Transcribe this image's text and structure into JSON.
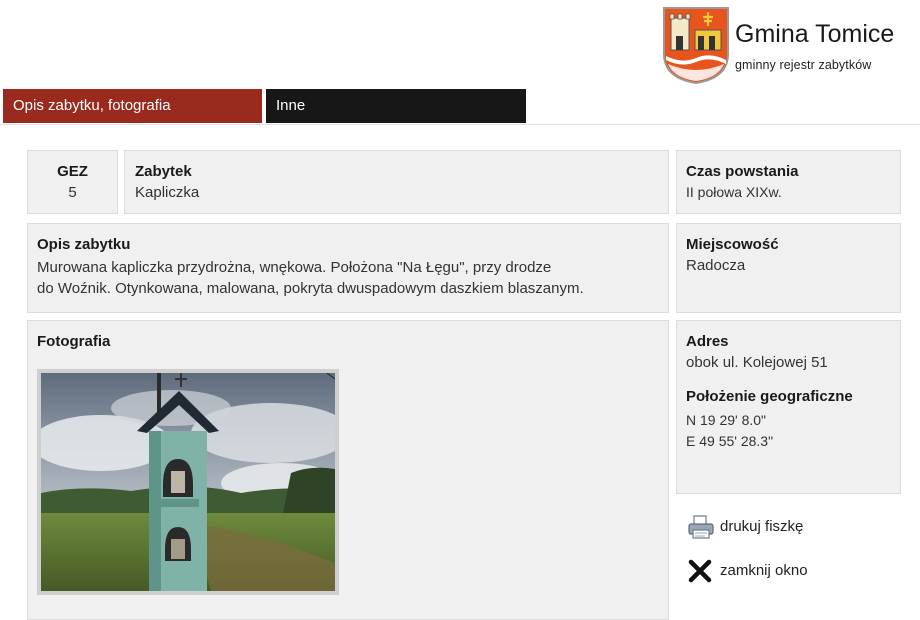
{
  "logo": {
    "title": "Gmina Tomice",
    "subtitle": "gminny rejestr zabytków"
  },
  "tabs": [
    {
      "label": "Opis zabytku, fotografia",
      "active": true
    },
    {
      "label": "Inne",
      "active": false
    }
  ],
  "colors": {
    "tab_active": "#9b2a1e",
    "tab_inactive": "#171717",
    "panel_bg": "#f0f0f0"
  },
  "record": {
    "gez": {
      "label": "GEZ",
      "value": "5"
    },
    "zabytek": {
      "label": "Zabytek",
      "value": "Kapliczka"
    },
    "czas": {
      "label": "Czas powstania",
      "value": "II połowa XIXw."
    },
    "opis": {
      "label": "Opis zabytku",
      "line1": "Murowana kapliczka przydrożna, wnękowa. Położona \"Na Łęgu\", przy drodze",
      "line2": "do Woźnik. Otynkowana, malowana, pokryta dwuspadowym daszkiem blaszanym."
    },
    "miejscowosc": {
      "label": "Miejscowość",
      "value": "Radocza"
    },
    "fotografia": {
      "label": "Fotografia"
    },
    "adres": {
      "label": "Adres",
      "value": "obok ul. Kolejowej 51"
    },
    "polozenie": {
      "label": "Położenie geograficzne",
      "n": "N 19 29' 8.0\"",
      "e": "E 49 55' 28.3\""
    }
  },
  "actions": {
    "print": {
      "label": "drukuj fiszkę",
      "icon": "printer-icon"
    },
    "close": {
      "label": "zamknij okno",
      "icon": "close-icon"
    }
  }
}
